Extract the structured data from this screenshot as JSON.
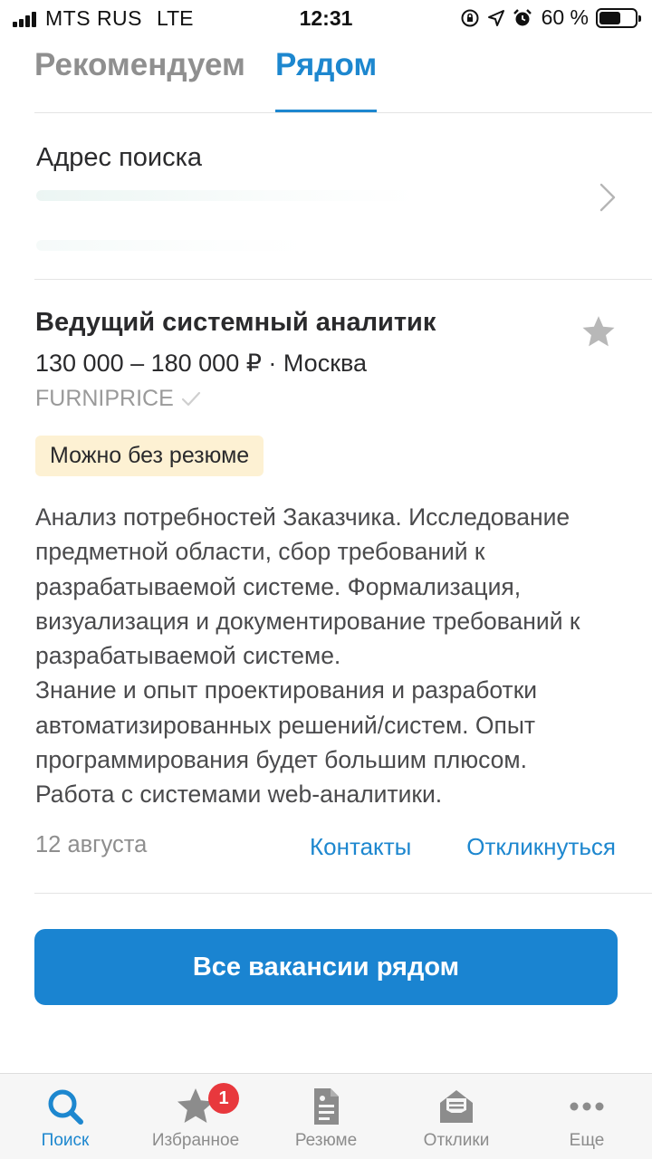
{
  "status_bar": {
    "carrier": "MTS RUS",
    "network": "LTE",
    "time": "12:31",
    "battery_percent_text": "60 %",
    "battery_level": 0.6,
    "icons": [
      "signal-icon",
      "orientation-lock-icon",
      "location-icon",
      "alarm-icon",
      "battery-icon"
    ]
  },
  "tabs": [
    {
      "label": "Рекомендуем",
      "active": false
    },
    {
      "label": "Рядом",
      "active": true
    }
  ],
  "address": {
    "title": "Адрес поиска",
    "icon": "chevron-right-icon"
  },
  "vacancy": {
    "title": "Ведущий системный аналитик",
    "salary_location": "130 000 – 180 000 ₽ · Москва",
    "company": "FURNIPRICE",
    "company_verified_icon": "checkmark-icon",
    "favorite_icon": "star-icon",
    "badge": "Можно без резюме",
    "description_lines": [
      "Анализ потребностей Заказчика. Исследование",
      "предметной области, сбор требований к",
      "разрабатываемой системе. Формализация,",
      "визуализация и документирование требований к",
      "разрабатываемой системе.",
      "Знание и опыт проектирования и разработки",
      "автоматизированных решений/систем. Опыт",
      "программирования будет большим плюсом.",
      "Работа с системами web-аналитики."
    ],
    "date": "12 августа",
    "contacts_label": "Контакты",
    "respond_label": "Откликнуться"
  },
  "all_nearby_button": "Все вакансии рядом",
  "colors": {
    "accent": "#1d87cf",
    "button": "#1a84d1",
    "badge_bg": "#fdf1d3",
    "notification": "#e8383d"
  },
  "bottom_nav": [
    {
      "label": "Поиск",
      "icon": "search-icon",
      "active": true
    },
    {
      "label": "Избранное",
      "icon": "star-icon",
      "badge": "1"
    },
    {
      "label": "Резюме",
      "icon": "document-icon"
    },
    {
      "label": "Отклики",
      "icon": "inbox-icon"
    },
    {
      "label": "Еще",
      "icon": "more-icon"
    }
  ]
}
